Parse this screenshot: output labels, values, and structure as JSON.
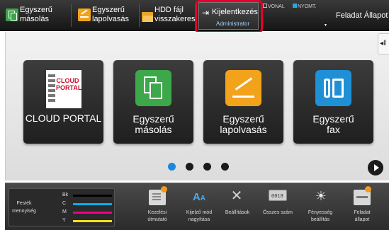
{
  "topbar": {
    "simple_copy_label": "Egyszerű\nmásolás",
    "simple_copy_l1": "Egyszerű",
    "simple_copy_l2": "másolás",
    "simple_scan_l1": "Egyszerű",
    "simple_scan_l2": "lapolvasás",
    "hdd_l1": "HDD fájl",
    "hdd_l2": "visszakeres",
    "logout_label": "Kijelentkezés",
    "logout_user": "Administrator",
    "line_label": "VONAL",
    "print_label": "NYOMT.",
    "job_status_label": "Feladat Állapot"
  },
  "tiles": [
    {
      "label": "CLOUD PORTAL",
      "logo_l1": "CLOUD",
      "logo_l2": "PORTAL"
    },
    {
      "l1": "Egyszerű",
      "l2": "másolás"
    },
    {
      "l1": "Egyszerű",
      "l2": "lapolvasás"
    },
    {
      "l1": "Egyszerű",
      "l2": "fax"
    }
  ],
  "pagination": {
    "pages": 4,
    "active": 1
  },
  "bottombar": {
    "toner_title_l1": "Festék",
    "toner_title_l2": "mennyiség",
    "toner_labels": [
      "Bk",
      "C",
      "M",
      "Y"
    ],
    "toner_colors": [
      "#000000",
      "#00aeef",
      "#ec008c",
      "#f7e21b"
    ],
    "items": [
      {
        "l1": "Kezelési",
        "l2": "útmutató"
      },
      {
        "l1": "Kijelző mód",
        "l2": "nagyítása"
      },
      {
        "l1": "Beállítások",
        "l2": ""
      },
      {
        "l1": "Összes szám",
        "l2": ""
      },
      {
        "l1": "Fényesség",
        "l2": "beállítás"
      },
      {
        "l1": "Feladat",
        "l2": "állapot"
      }
    ]
  },
  "colors": {
    "highlight": "#e4002b",
    "accent_blue": "#1f86dd",
    "copy_green": "#3da84a",
    "scan_orange": "#f2a21b",
    "fax_blue": "#1f8fd6"
  }
}
